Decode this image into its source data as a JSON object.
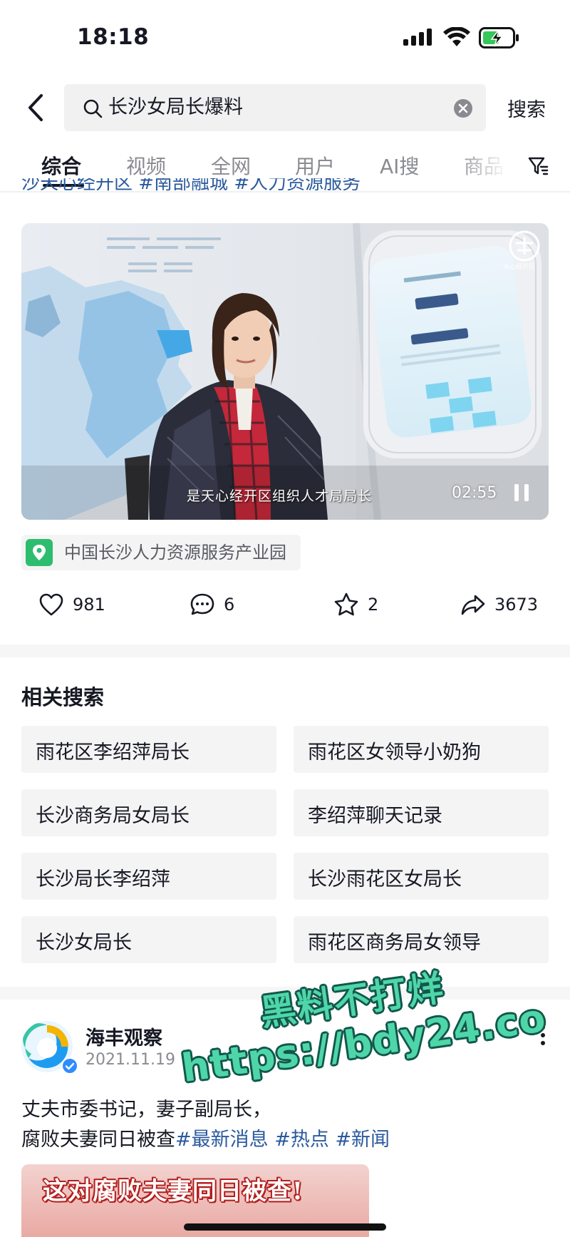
{
  "status_bar": {
    "time": "18:18"
  },
  "search": {
    "query": "长沙女局长爆料",
    "button_label": "搜索"
  },
  "tabs": [
    {
      "label": "综合",
      "active": true
    },
    {
      "label": "视频"
    },
    {
      "label": "全网"
    },
    {
      "label": "用户"
    },
    {
      "label": "AI搜"
    },
    {
      "label": "商品"
    }
  ],
  "post1": {
    "clipped_tags": "沙天心经开区 #南部融城 #人力资源服务",
    "video": {
      "caption": "是天心经开区组织人才局局长",
      "duration": "02:55",
      "channel_logo_text": "天心经开区"
    },
    "location": "中国长沙人力资源服务产业园",
    "stats": {
      "likes": "981",
      "comments": "6",
      "favorites": "2",
      "shares": "3673"
    }
  },
  "related": {
    "title": "相关搜索",
    "items": [
      "雨花区李绍萍局长",
      "雨花区女领导小奶狗",
      "长沙商务局女局长",
      "李绍萍聊天记录",
      "长沙局长李绍萍",
      "长沙雨花区女局长",
      "长沙女局长",
      "雨花区商务局女领导"
    ]
  },
  "post2": {
    "author": "海丰观察",
    "date": "2021.11.19",
    "text_line1": "丈夫市委书记，妻子副局长，",
    "text_line2": "腐败夫妻同日被查",
    "tags": [
      "#最新消息",
      "#热点",
      "#新闻"
    ],
    "thumbnail_headline": "这对腐败夫妻同日被查!"
  },
  "watermark": {
    "line1": "黑料不打烊",
    "line2": "https://bdy24.co"
  },
  "colors": {
    "tag_blue": "#2a5a9e",
    "location_green": "#2dbd6e",
    "watermark_green": "#4fd6a8"
  },
  "icons": [
    "back-icon",
    "search-icon",
    "clear-icon",
    "filter-icon",
    "pause-icon",
    "location-pin-icon",
    "heart-icon",
    "comment-icon",
    "star-icon",
    "share-icon",
    "more-icon",
    "verified-icon"
  ]
}
